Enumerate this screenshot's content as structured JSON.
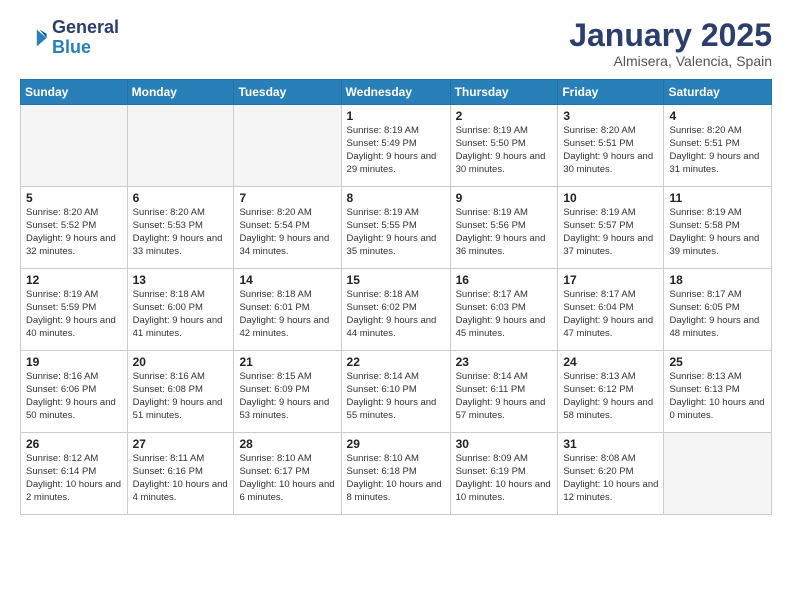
{
  "header": {
    "logo_general": "General",
    "logo_blue": "Blue",
    "title": "January 2025",
    "subtitle": "Almisera, Valencia, Spain"
  },
  "weekdays": [
    "Sunday",
    "Monday",
    "Tuesday",
    "Wednesday",
    "Thursday",
    "Friday",
    "Saturday"
  ],
  "weeks": [
    [
      {
        "day": "",
        "info": "",
        "empty": true
      },
      {
        "day": "",
        "info": "",
        "empty": true
      },
      {
        "day": "",
        "info": "",
        "empty": true
      },
      {
        "day": "1",
        "info": "Sunrise: 8:19 AM\nSunset: 5:49 PM\nDaylight: 9 hours\nand 29 minutes."
      },
      {
        "day": "2",
        "info": "Sunrise: 8:19 AM\nSunset: 5:50 PM\nDaylight: 9 hours\nand 30 minutes."
      },
      {
        "day": "3",
        "info": "Sunrise: 8:20 AM\nSunset: 5:51 PM\nDaylight: 9 hours\nand 30 minutes."
      },
      {
        "day": "4",
        "info": "Sunrise: 8:20 AM\nSunset: 5:51 PM\nDaylight: 9 hours\nand 31 minutes."
      }
    ],
    [
      {
        "day": "5",
        "info": "Sunrise: 8:20 AM\nSunset: 5:52 PM\nDaylight: 9 hours\nand 32 minutes."
      },
      {
        "day": "6",
        "info": "Sunrise: 8:20 AM\nSunset: 5:53 PM\nDaylight: 9 hours\nand 33 minutes."
      },
      {
        "day": "7",
        "info": "Sunrise: 8:20 AM\nSunset: 5:54 PM\nDaylight: 9 hours\nand 34 minutes."
      },
      {
        "day": "8",
        "info": "Sunrise: 8:19 AM\nSunset: 5:55 PM\nDaylight: 9 hours\nand 35 minutes."
      },
      {
        "day": "9",
        "info": "Sunrise: 8:19 AM\nSunset: 5:56 PM\nDaylight: 9 hours\nand 36 minutes."
      },
      {
        "day": "10",
        "info": "Sunrise: 8:19 AM\nSunset: 5:57 PM\nDaylight: 9 hours\nand 37 minutes."
      },
      {
        "day": "11",
        "info": "Sunrise: 8:19 AM\nSunset: 5:58 PM\nDaylight: 9 hours\nand 39 minutes."
      }
    ],
    [
      {
        "day": "12",
        "info": "Sunrise: 8:19 AM\nSunset: 5:59 PM\nDaylight: 9 hours\nand 40 minutes."
      },
      {
        "day": "13",
        "info": "Sunrise: 8:18 AM\nSunset: 6:00 PM\nDaylight: 9 hours\nand 41 minutes."
      },
      {
        "day": "14",
        "info": "Sunrise: 8:18 AM\nSunset: 6:01 PM\nDaylight: 9 hours\nand 42 minutes."
      },
      {
        "day": "15",
        "info": "Sunrise: 8:18 AM\nSunset: 6:02 PM\nDaylight: 9 hours\nand 44 minutes."
      },
      {
        "day": "16",
        "info": "Sunrise: 8:17 AM\nSunset: 6:03 PM\nDaylight: 9 hours\nand 45 minutes."
      },
      {
        "day": "17",
        "info": "Sunrise: 8:17 AM\nSunset: 6:04 PM\nDaylight: 9 hours\nand 47 minutes."
      },
      {
        "day": "18",
        "info": "Sunrise: 8:17 AM\nSunset: 6:05 PM\nDaylight: 9 hours\nand 48 minutes."
      }
    ],
    [
      {
        "day": "19",
        "info": "Sunrise: 8:16 AM\nSunset: 6:06 PM\nDaylight: 9 hours\nand 50 minutes."
      },
      {
        "day": "20",
        "info": "Sunrise: 8:16 AM\nSunset: 6:08 PM\nDaylight: 9 hours\nand 51 minutes."
      },
      {
        "day": "21",
        "info": "Sunrise: 8:15 AM\nSunset: 6:09 PM\nDaylight: 9 hours\nand 53 minutes."
      },
      {
        "day": "22",
        "info": "Sunrise: 8:14 AM\nSunset: 6:10 PM\nDaylight: 9 hours\nand 55 minutes."
      },
      {
        "day": "23",
        "info": "Sunrise: 8:14 AM\nSunset: 6:11 PM\nDaylight: 9 hours\nand 57 minutes."
      },
      {
        "day": "24",
        "info": "Sunrise: 8:13 AM\nSunset: 6:12 PM\nDaylight: 9 hours\nand 58 minutes."
      },
      {
        "day": "25",
        "info": "Sunrise: 8:13 AM\nSunset: 6:13 PM\nDaylight: 10 hours\nand 0 minutes."
      }
    ],
    [
      {
        "day": "26",
        "info": "Sunrise: 8:12 AM\nSunset: 6:14 PM\nDaylight: 10 hours\nand 2 minutes."
      },
      {
        "day": "27",
        "info": "Sunrise: 8:11 AM\nSunset: 6:16 PM\nDaylight: 10 hours\nand 4 minutes."
      },
      {
        "day": "28",
        "info": "Sunrise: 8:10 AM\nSunset: 6:17 PM\nDaylight: 10 hours\nand 6 minutes."
      },
      {
        "day": "29",
        "info": "Sunrise: 8:10 AM\nSunset: 6:18 PM\nDaylight: 10 hours\nand 8 minutes."
      },
      {
        "day": "30",
        "info": "Sunrise: 8:09 AM\nSunset: 6:19 PM\nDaylight: 10 hours\nand 10 minutes."
      },
      {
        "day": "31",
        "info": "Sunrise: 8:08 AM\nSunset: 6:20 PM\nDaylight: 10 hours\nand 12 minutes."
      },
      {
        "day": "",
        "info": "",
        "empty": true
      }
    ]
  ]
}
